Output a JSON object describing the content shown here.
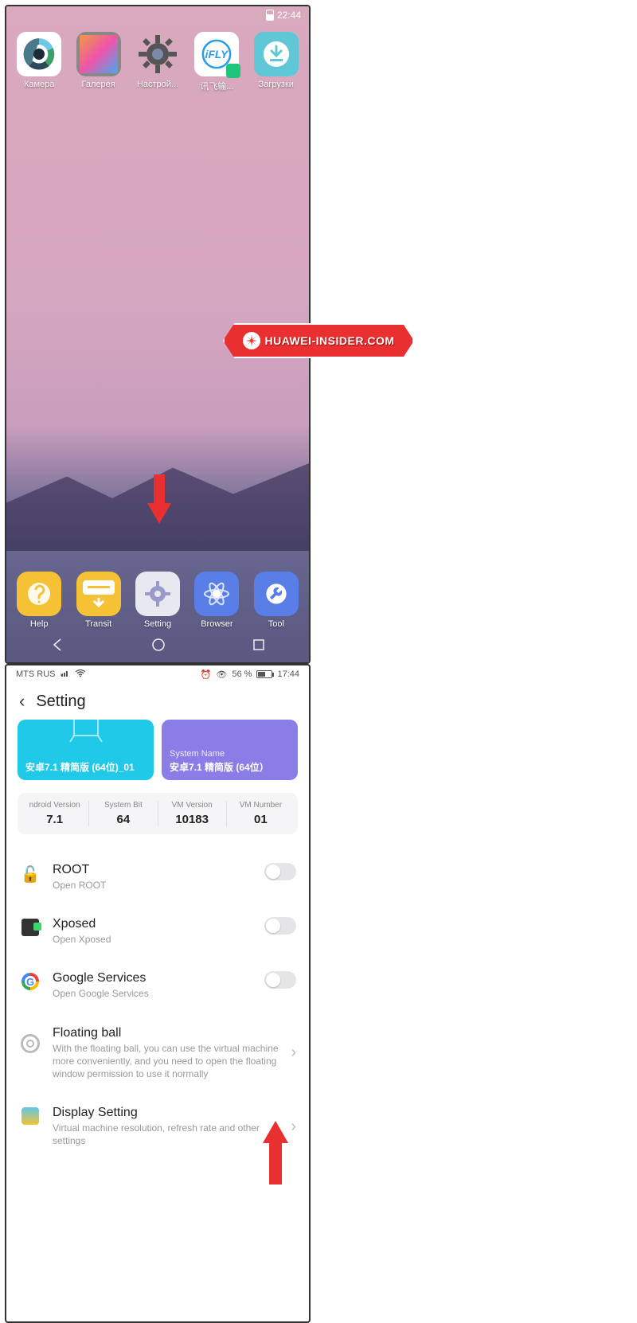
{
  "left": {
    "status": {
      "time": "22:44"
    },
    "apps": [
      {
        "label": "Камера",
        "icon": "camera"
      },
      {
        "label": "Галерея",
        "icon": "gallery"
      },
      {
        "label": "Настрой...",
        "icon": "settings"
      },
      {
        "label": "讯飞输...",
        "icon": "ifly"
      },
      {
        "label": "Загрузки",
        "icon": "download"
      }
    ],
    "dock": [
      {
        "label": "Help",
        "icon": "help"
      },
      {
        "label": "Transit",
        "icon": "transit"
      },
      {
        "label": "Setting",
        "icon": "setting"
      },
      {
        "label": "Browser",
        "icon": "browser"
      },
      {
        "label": "Tool",
        "icon": "tool"
      }
    ]
  },
  "right": {
    "status": {
      "carrier": "MTS RUS",
      "battery_pct": "56 %",
      "time": "17:44"
    },
    "header": {
      "title": "Setting"
    },
    "cards": {
      "cyan": {
        "text": "安卓7.1 精简版 (64位)_01"
      },
      "purple": {
        "sysname": "System Name",
        "text": "安卓7.1 精简版 (64位）"
      }
    },
    "info": [
      {
        "label": "ndroid Version",
        "value": "7.1"
      },
      {
        "label": "System Bit",
        "value": "64"
      },
      {
        "label": "VM Version",
        "value": "10183"
      },
      {
        "label": "VM Number",
        "value": "01"
      }
    ],
    "items": {
      "root": {
        "title": "ROOT",
        "sub": "Open ROOT"
      },
      "xposed": {
        "title": "Xposed",
        "sub": "Open Xposed"
      },
      "google": {
        "title": "Google Services",
        "sub": "Open Google Services"
      },
      "float": {
        "title": "Floating ball",
        "sub": "With the floating ball, you can use the virtual machine more conveniently, and you need to open the floating window permission to use it normally"
      },
      "display": {
        "title": "Display Setting",
        "sub": "Virtual machine resolution, refresh rate and other settings"
      }
    }
  },
  "watermark": {
    "text": "HUAWEI-INSIDER.COM"
  }
}
